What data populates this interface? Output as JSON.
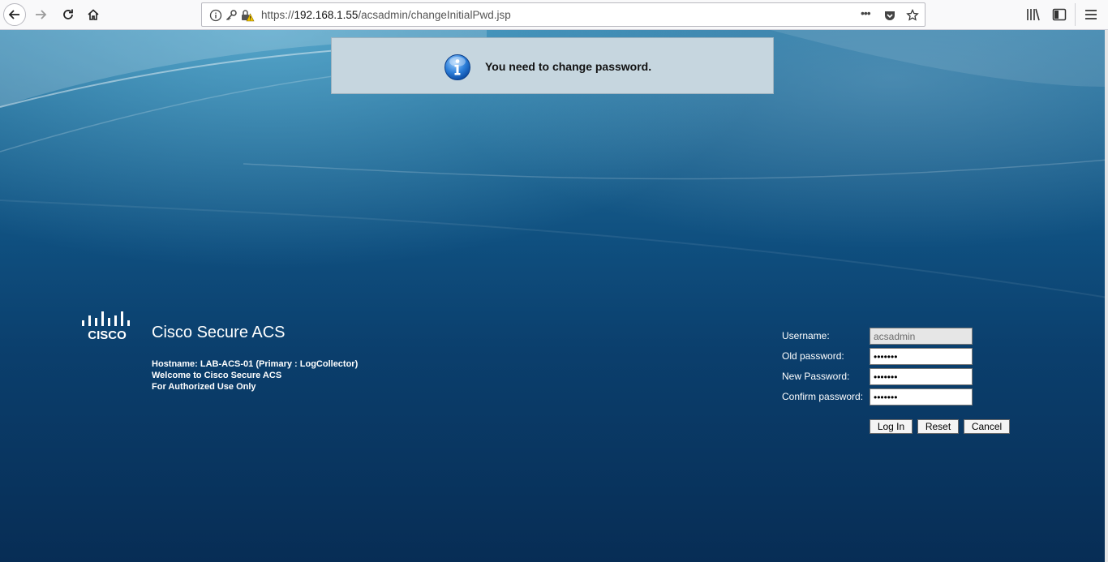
{
  "browser": {
    "url_prefix": "https://",
    "url_host": "192.168.1.55",
    "url_path": "/acsadmin/changeInitialPwd.jsp",
    "more_label": "•••"
  },
  "notice": {
    "message": "You need to change password."
  },
  "brand": {
    "logo_text": "CISCO",
    "product": "Cisco Secure ACS",
    "hostname_line": "Hostname: LAB-ACS-01 (Primary : LogCollector)",
    "welcome_line": "Welcome to Cisco Secure ACS",
    "authorized_line": "For Authorized Use Only"
  },
  "form": {
    "username_label": "Username:",
    "username_value": "acsadmin",
    "old_password_label": "Old password:",
    "old_password_value": "•••••••",
    "new_password_label": "New Password:",
    "new_password_value": "•••••••",
    "confirm_password_label": "Confirm password:",
    "confirm_password_value": "•••••••",
    "login_label": "Log In",
    "reset_label": "Reset",
    "cancel_label": "Cancel"
  },
  "colors": {
    "notice_bg": "#c6d6df",
    "page_bg": "#0b3156"
  }
}
